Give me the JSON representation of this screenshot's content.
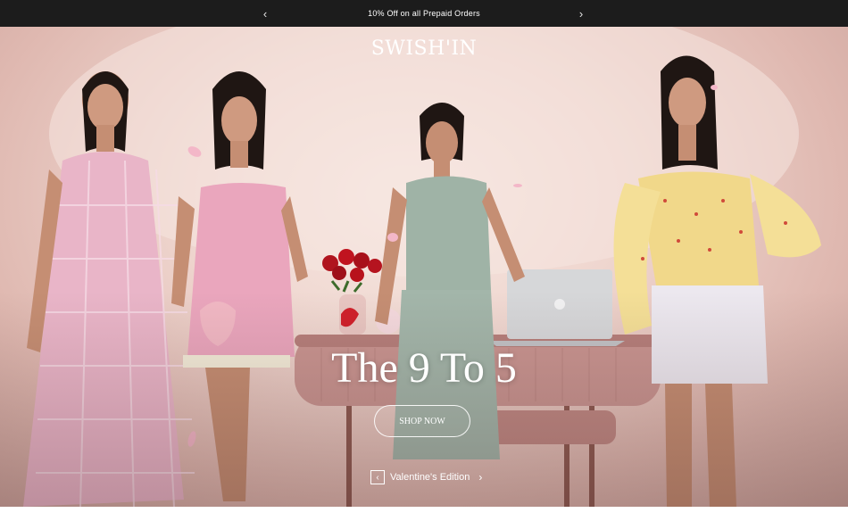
{
  "announcement": {
    "text": "10% Off on all Prepaid Orders",
    "prev_icon": "chevron-left-icon",
    "next_icon": "chevron-right-icon"
  },
  "brand": {
    "logo": "SWISH'IN"
  },
  "hero": {
    "headline": "The 9 To 5",
    "cta_label": "SHOP NOW",
    "collection_label": "Valentine's Edition",
    "image_description_colors": {
      "background": "#efd6cf",
      "dress_pink": "#e8a9bd",
      "dress_green": "#9fb3a6",
      "top_yellow": "#f1d88a",
      "table_pink": "#c99591"
    }
  },
  "colors": {
    "bar": "#1c1c1c",
    "text": "#ffffff"
  }
}
